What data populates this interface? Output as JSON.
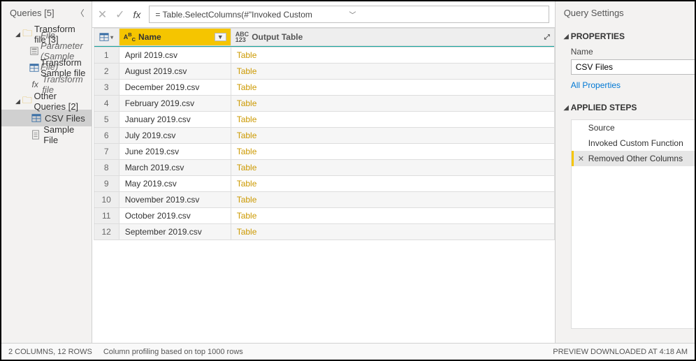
{
  "queries_pane": {
    "title": "Queries [5]",
    "groups": [
      {
        "label": "Transform file [3]",
        "expanded": true,
        "children": [
          {
            "label": "File Parameter (Sample File)",
            "kind": "param",
            "italic": true
          },
          {
            "label": "Transform Sample file",
            "kind": "table"
          },
          {
            "label": "Transform file",
            "kind": "fx",
            "italic": true
          }
        ]
      },
      {
        "label": "Other Queries [2]",
        "expanded": true,
        "children": [
          {
            "label": "CSV Files",
            "kind": "table",
            "selected": true
          },
          {
            "label": "Sample File",
            "kind": "sheet"
          }
        ]
      }
    ]
  },
  "formula_bar": {
    "text": "= Table.SelectColumns(#\"Invoked Custom"
  },
  "table": {
    "col1_header": "Name",
    "col2_header": "Output Table",
    "rows": [
      {
        "n": 1,
        "name": "April 2019.csv",
        "out": "Table"
      },
      {
        "n": 2,
        "name": "August 2019.csv",
        "out": "Table"
      },
      {
        "n": 3,
        "name": "December 2019.csv",
        "out": "Table"
      },
      {
        "n": 4,
        "name": "February 2019.csv",
        "out": "Table"
      },
      {
        "n": 5,
        "name": "January 2019.csv",
        "out": "Table"
      },
      {
        "n": 6,
        "name": "July 2019.csv",
        "out": "Table"
      },
      {
        "n": 7,
        "name": "June 2019.csv",
        "out": "Table"
      },
      {
        "n": 8,
        "name": "March 2019.csv",
        "out": "Table"
      },
      {
        "n": 9,
        "name": "May 2019.csv",
        "out": "Table"
      },
      {
        "n": 10,
        "name": "November 2019.csv",
        "out": "Table"
      },
      {
        "n": 11,
        "name": "October 2019.csv",
        "out": "Table"
      },
      {
        "n": 12,
        "name": "September 2019.csv",
        "out": "Table"
      }
    ]
  },
  "settings": {
    "title": "Query Settings",
    "properties_label": "PROPERTIES",
    "name_label": "Name",
    "name_value": "CSV Files",
    "all_props": "All Properties",
    "applied_steps_label": "APPLIED STEPS",
    "steps": [
      {
        "label": "Source",
        "gear": true
      },
      {
        "label": "Invoked Custom Function",
        "gear": true
      },
      {
        "label": "Removed Other Columns",
        "gear": true,
        "selected": true,
        "delete": true
      }
    ]
  },
  "status": {
    "cols_rows": "2 COLUMNS, 12 ROWS",
    "profiling": "Column profiling based on top 1000 rows",
    "preview": "PREVIEW DOWNLOADED AT 4:18 AM"
  }
}
